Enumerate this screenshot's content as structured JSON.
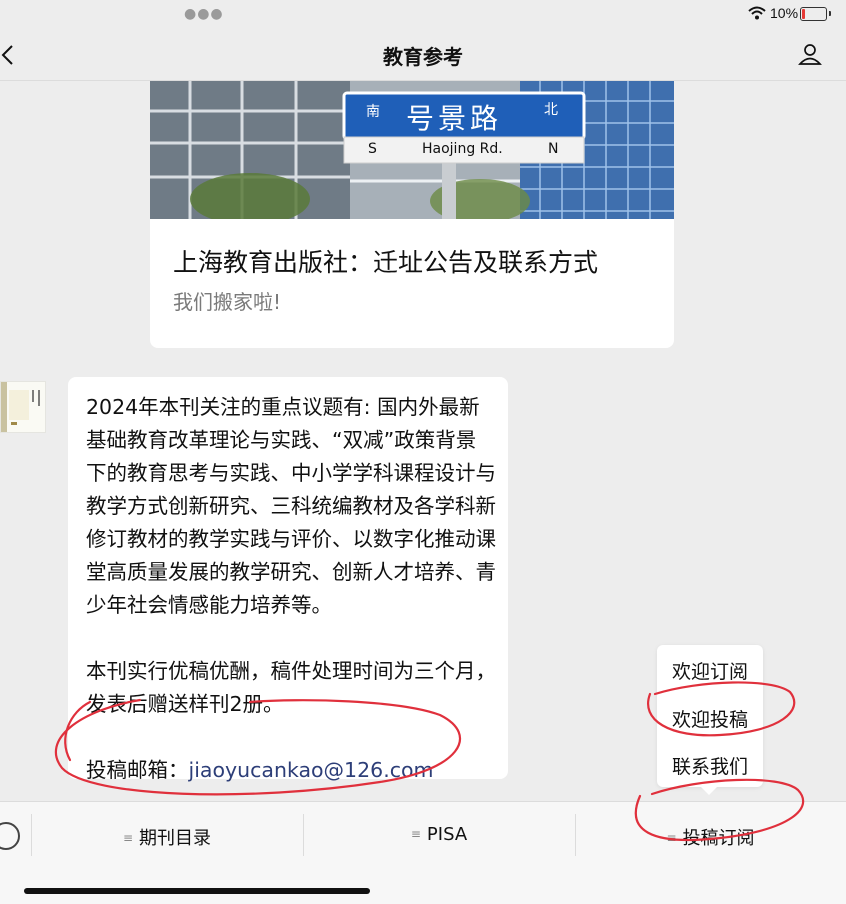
{
  "status": {
    "battery": "10%"
  },
  "nav": {
    "title": "教育参考"
  },
  "article": {
    "title": "上海教育出版社：迁址公告及联系方式",
    "subtitle": "我们搬家啦!",
    "sign": {
      "cn": "号景路",
      "left": "南",
      "right": "北",
      "s": "S",
      "n": "N",
      "en": "Haojing Rd."
    }
  },
  "message": {
    "paragraph1": "2024年本刊关注的重点议题有: 国内外最新基础教育改革理论与实践、“双减”政策背景下的教育思考与实践、中小学学科课程设计与教学方式创新研究、三科统编教材及各学科新修订教材的教学实践与评价、以数字化推动课堂高质量发展的教学研究、创新人才培养、青少年社会情感能力培养等。",
    "paragraph2": "本刊实行优稿优酬，稿件处理时间为三个月，发表后赠送样刊2册。",
    "email_label": "投稿邮箱：",
    "email": "jiaoyucankao@126.com"
  },
  "popup": {
    "items": [
      "欢迎订阅",
      "欢迎投稿",
      "联系我们"
    ]
  },
  "bottom_menu": {
    "items": [
      "期刊目录",
      "PISA",
      "投稿订阅"
    ]
  },
  "colors": {
    "annotation": "#e0303c",
    "link": "#2d3e78"
  }
}
